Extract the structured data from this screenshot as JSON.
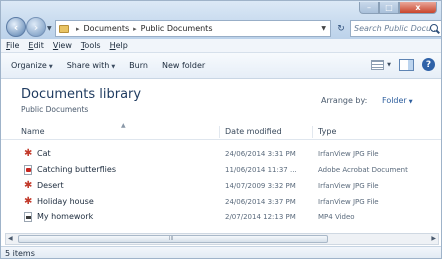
{
  "window": {
    "controls": {
      "minimize": "–",
      "maximize": "□",
      "close": "x"
    }
  },
  "address": {
    "crumbs": [
      "Documents",
      "Public Documents"
    ],
    "separator": "▸",
    "search_placeholder": "Search Public Docu..."
  },
  "menu": [
    {
      "accel": "F",
      "rest": "ile"
    },
    {
      "accel": "E",
      "rest": "dit"
    },
    {
      "accel": "V",
      "rest": "iew"
    },
    {
      "accel": "T",
      "rest": "ools"
    },
    {
      "accel": "H",
      "rest": "elp"
    }
  ],
  "toolbar": {
    "organize": "Organize",
    "share_with": "Share with",
    "burn": "Burn",
    "new_folder": "New folder",
    "help_glyph": "?"
  },
  "library": {
    "title": "Documents library",
    "subtitle": "Public Documents",
    "arrange_label": "Arrange by:",
    "arrange_value": "Folder"
  },
  "columns": {
    "name": "Name",
    "date": "Date modified",
    "type": "Type"
  },
  "files": [
    {
      "name": "Cat",
      "date": "24/06/2014 3:31 PM",
      "type": "IrfanView JPG File",
      "icon": "irfanview-icon"
    },
    {
      "name": "Catching butterflies",
      "date": "11/06/2014 11:37 ...",
      "type": "Adobe Acrobat Document",
      "icon": "pdf-icon"
    },
    {
      "name": "Desert",
      "date": "14/07/2009 3:32 PM",
      "type": "IrfanView JPG File",
      "icon": "irfanview-icon"
    },
    {
      "name": "Holiday house",
      "date": "24/06/2014 3:37 PM",
      "type": "IrfanView JPG File",
      "icon": "irfanview-icon"
    },
    {
      "name": "My homework",
      "date": "2/07/2014 12:13 PM",
      "type": "MP4 Video",
      "icon": "video-icon"
    }
  ],
  "status": {
    "item_count": "5 items"
  },
  "colors": {
    "accent": "#2e5f9e",
    "irfanview": "#c23a2b",
    "title_text": "#1e3a5f"
  }
}
